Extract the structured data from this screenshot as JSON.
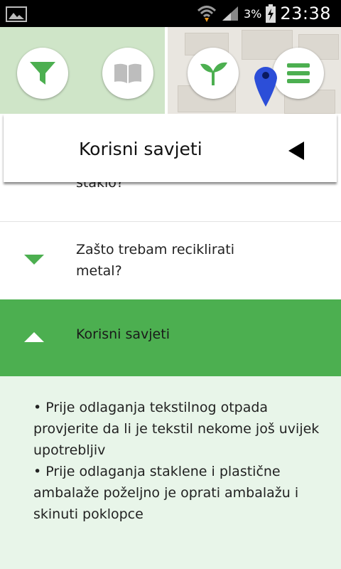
{
  "status_bar": {
    "battery_percent": "3%",
    "time": "23:38",
    "icons": [
      "gallery-icon",
      "wifi-icon",
      "signal-icon",
      "battery-charging-icon"
    ]
  },
  "toolbar": {
    "buttons": [
      {
        "name": "filter",
        "icon": "filter-icon"
      },
      {
        "name": "book",
        "icon": "book-icon"
      },
      {
        "name": "plant",
        "icon": "sprout-icon"
      },
      {
        "name": "menu",
        "icon": "menu-icon"
      }
    ],
    "accent_color": "#4caf50"
  },
  "header": {
    "title": "Korisni savjeti",
    "back_icon": "back-triangle-icon"
  },
  "list": {
    "partial_item": "staklo?",
    "items": [
      {
        "label": "Zašto trebam reciklirati metal?",
        "expanded": false,
        "icon": "chevron-down-icon"
      },
      {
        "label": "Korisni savjeti",
        "expanded": true,
        "icon": "chevron-up-icon"
      }
    ],
    "expanded_content": [
      "•  Prije odlaganja tekstilnog otpada provjerite da li je tekstil nekome još uvijek upotrebljiv",
      "•  Prije odlaganja staklene i plastične ambalaže poželjno je oprati ambalažu i skinuti poklopce"
    ]
  }
}
